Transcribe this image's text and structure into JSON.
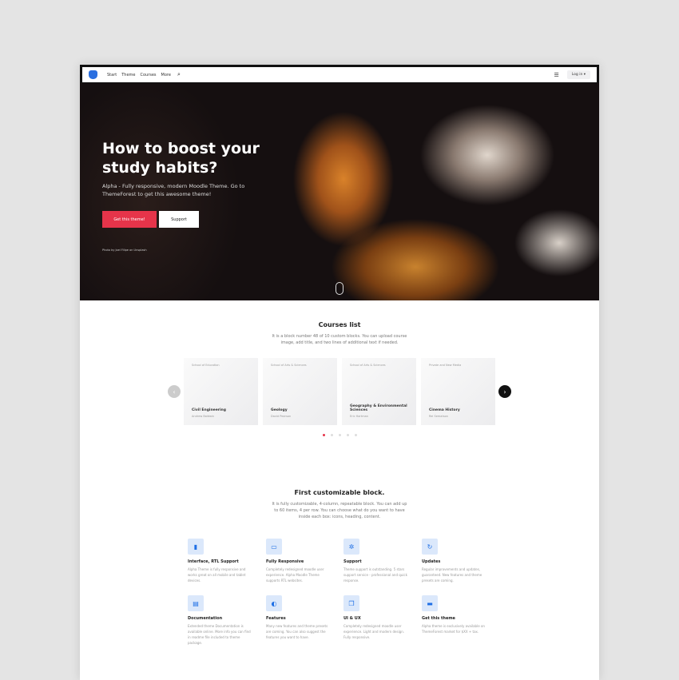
{
  "nav": {
    "links": [
      "Start",
      "Theme",
      "Courses",
      "More"
    ],
    "login": "Log in ▾"
  },
  "hero": {
    "title": "How to boost your study habits?",
    "subtitle": "Alpha - Fully responsive, modern Moodle Theme. Go to ThemeForest to get this awesome theme!",
    "primary_button": "Get this theme!",
    "secondary_button": "Support",
    "credit": "Photo by Joel Filipe on Unsplash"
  },
  "courses": {
    "title": "Courses list",
    "description": "It is a block number 48 of 10 custom blocks. You can upload course image, add title, and two lines of additional text if needed.",
    "items": [
      {
        "category": "School of Education",
        "title": "Civil Engineering",
        "author": "Andrew Baldwin"
      },
      {
        "category": "School of Arts & Sciences",
        "title": "Geology",
        "author": "David Pearson"
      },
      {
        "category": "School of Arts & Sciences",
        "title": "Geography & Environmental Sciences",
        "author": "Eric Hartman"
      },
      {
        "category": "Private and New Media",
        "title": "Cinema History",
        "author": "Rei Sematson"
      }
    ],
    "active_page": 1,
    "pages": 5
  },
  "block": {
    "title": "First customizable block.",
    "description": "It is fully customizable, 4-column, repeatable block. You can add up to 60 items, 4 per row. You can choose what do you want to have inside each box: icons, heading, content.",
    "features": [
      {
        "icon": "mobile-icon",
        "title": "Interface, RTL Support",
        "text": "Alpha Theme is fully responsive and works great on all mobile and tablet devices."
      },
      {
        "icon": "responsive-icon",
        "title": "Fully Responsive",
        "text": "Completely redesigned moodle user experience. Alpha Moodle Theme supports RTL websites."
      },
      {
        "icon": "support-icon",
        "title": "Support",
        "text": "Theme support is outstanding. 5 stars support service - professional and quick response."
      },
      {
        "icon": "updates-icon",
        "title": "Updates",
        "text": "Regular improvements and updates, guaranteed. New features and theme presets are coming."
      },
      {
        "icon": "documentation-icon",
        "title": "Documentation",
        "text": "Extended theme Documentation is available online. More info you can find in readme file included to theme package."
      },
      {
        "icon": "shield-icon",
        "title": "Features",
        "text": "Many new features and theme presets are coming. You can also suggest the features you want to have."
      },
      {
        "icon": "layers-icon",
        "title": "UI & UX",
        "text": "Completely redesigned moodle user experience. Light and modern design. Fully responsive."
      },
      {
        "icon": "store-icon",
        "title": "Get this theme",
        "text": "Alpha theme is exclusively available on ThemeForest market for $XX + tax."
      }
    ]
  }
}
